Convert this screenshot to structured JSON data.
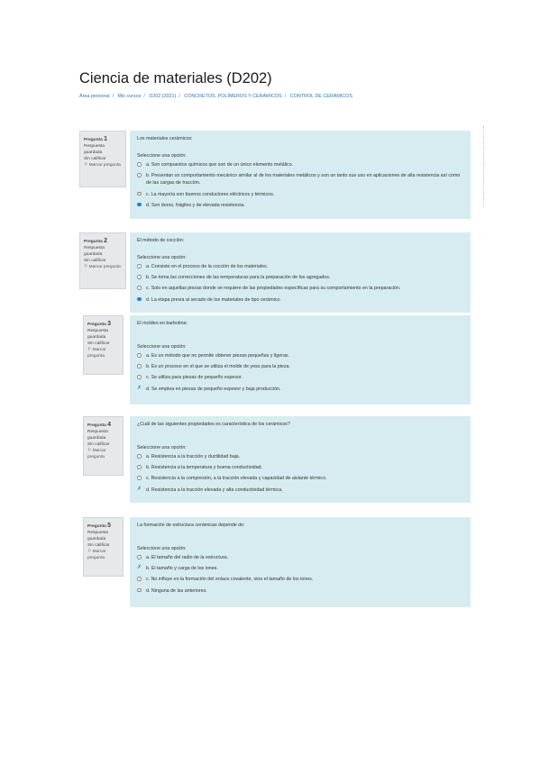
{
  "page": {
    "title": "Ciencia de materiales (D202)",
    "breadcrumb": [
      "Área personal",
      "Mis cursos",
      "D202 (2021)",
      "CONCRETOS, POLÍMEROS Y CERÁMICOS",
      "CONTROL DE CERÁMICOS"
    ]
  },
  "questions": [
    {
      "number_label": "Pregunta",
      "number": "1",
      "status": "Respuesta guardada",
      "points": "Sin calificar",
      "flag": "Marcar pregunta",
      "text": "Los materiales cerámicos:",
      "instruction": "Seleccione una opción:",
      "options": [
        {
          "text": "a. Son compuestos químicos que son de un único elemento metálico.",
          "selected": false
        },
        {
          "text": "b. Presentan un comportamiento mecánico similar al de los materiales metálicos y son un tanto sus uso en aplicaciones de alta resistencia así como de las cargas de tracción.",
          "selected": false
        },
        {
          "text": "c. La mayoría son buenos conductores eléctricos y térmicos.",
          "selected": false
        },
        {
          "text": "d. Son duros, frágiles y de elevada resistencia.",
          "selected": true
        }
      ]
    },
    {
      "number_label": "Pregunta",
      "number": "2",
      "status": "Respuesta guardada",
      "points": "Sin calificar",
      "flag": "Marcar pregunta",
      "text": "El método de cocción:",
      "instruction": "Seleccione una opción:",
      "options": [
        {
          "text": "a. Consiste en el proceso de la cocción de los materiales.",
          "selected": false
        },
        {
          "text": "b. Se toma las correcciones de las temperaturas para la preparación de los agregados.",
          "selected": false
        },
        {
          "text": "c. Solo en aquellas piezas donde se requiere de las propiedades específicas para su comportamiento en la preparación.",
          "selected": false
        },
        {
          "text": "d. La etapa previa al secado de los materiales de tipo cerámico.",
          "selected": true
        }
      ]
    },
    {
      "number_label": "Pregunta",
      "number": "3",
      "status": "Respuesta guardada",
      "points": "Sin calificar",
      "flag": "Marcar pregunta",
      "text": "El moldeo en barbotina:",
      "instruction": "Seleccione una opción:",
      "options": [
        {
          "text": "a. Es un método que no permite obtener piezas pequeñas y ligeras.",
          "selected": false
        },
        {
          "text": "b. Es un proceso en el que se utiliza el molde de yeso para la pieza.",
          "selected": false
        },
        {
          "text": "c. Se utiliza para piezas de pequeño espesor.",
          "selected": false
        },
        {
          "text": "d. Se emplea en piezas de pequeño espesor y baja producción.",
          "selected": true
        }
      ]
    },
    {
      "number_label": "Pregunta",
      "number": "4",
      "status": "Respuesta guardada",
      "points": "Sin calificar",
      "flag": "Marcar pregunta",
      "text": "¿Cuál de las siguientes propiedades es característica de los cerámicos?",
      "instruction": "Seleccione una opción:",
      "options": [
        {
          "text": "a. Resistencia a la tracción y ductilidad baja.",
          "selected": false
        },
        {
          "text": "b. Resistencia a la temperatura y buena conductividad.",
          "selected": false
        },
        {
          "text": "c. Resistencia a la compresión, a la tracción elevada y capacidad de aislante térmico.",
          "selected": false
        },
        {
          "text": "d. Resistencia a la tracción elevada y alta conductividad térmica.",
          "selected": true
        }
      ]
    },
    {
      "number_label": "Pregunta",
      "number": "5",
      "status": "Respuesta guardada",
      "points": "Sin calificar",
      "flag": "Marcar pregunta",
      "text": "La formación de estructura cerámicas depende de:",
      "instruction": "Seleccione una opción:",
      "options": [
        {
          "text": "a. El tamaño del radio de la estructura.",
          "selected": false
        },
        {
          "text": "b. El tamaño y carga de los iones.",
          "selected": true
        },
        {
          "text": "c. No influye en la formación del enlace covalente, sino el tamaño de los iones.",
          "selected": false
        },
        {
          "text": "d. Ninguna de las anteriores.",
          "selected": false
        }
      ]
    }
  ]
}
